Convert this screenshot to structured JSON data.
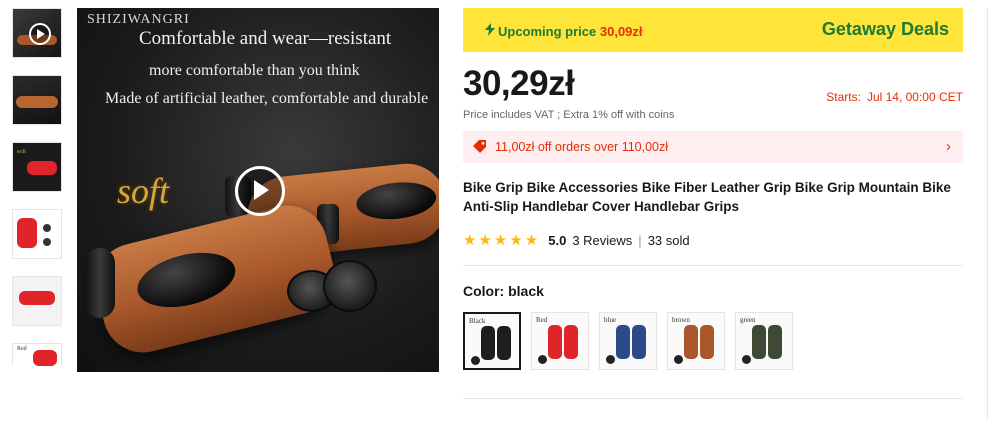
{
  "gallery": {
    "thumbnails": [
      "video",
      "brown-grips",
      "red-grips-soft",
      "red-grips-detail",
      "red-grips-white",
      "red-grips-label"
    ],
    "thumb_labels": {
      "t3": "soft",
      "t6": "Red"
    },
    "main_image": {
      "brand": "SHIZIWANGRI",
      "line1": "Comfortable and wear—resistant",
      "line2": "more comfortable than you think",
      "line3": "Made of artificial leather, comfortable and durable",
      "soft": "soft"
    }
  },
  "deal": {
    "upcoming_label": "Upcoming price",
    "upcoming_price": "30,09zł",
    "deal_name": "Getaway Deals",
    "icon": "lightning-icon"
  },
  "price": {
    "current": "30,29zł",
    "starts_label": "Starts:",
    "starts_value": "Jul 14, 00:00 CET",
    "vat_note": "Price includes VAT ; Extra 1% off with coins"
  },
  "coupon": {
    "text": "11,00zł off orders over 110,00zł",
    "icon": "tag-icon",
    "chevron": "›"
  },
  "product": {
    "title": "Bike Grip Bike Accessories Bike Fiber Leather Grip Bike Grip Mountain Bike Anti-Slip Handlebar Cover Handlebar Grips",
    "rating": "5.0",
    "stars": "★★★★★",
    "reviews": "3 Reviews",
    "sold": "33 sold",
    "separator": "|"
  },
  "variants": {
    "label": "Color: black",
    "options": [
      {
        "label": "Black",
        "color": "#1e1e1e",
        "selected": true
      },
      {
        "label": "Red",
        "color": "#e0242a"
      },
      {
        "label": "blue",
        "color": "#2a4a8a"
      },
      {
        "label": "brown",
        "color": "#a8562a"
      },
      {
        "label": "green",
        "color": "#3e4a34"
      }
    ]
  },
  "colors": {
    "accent_red": "#e62e04",
    "deal_yellow": "#ffe43a",
    "deal_green": "#1d7b34",
    "star": "#fdb813"
  }
}
